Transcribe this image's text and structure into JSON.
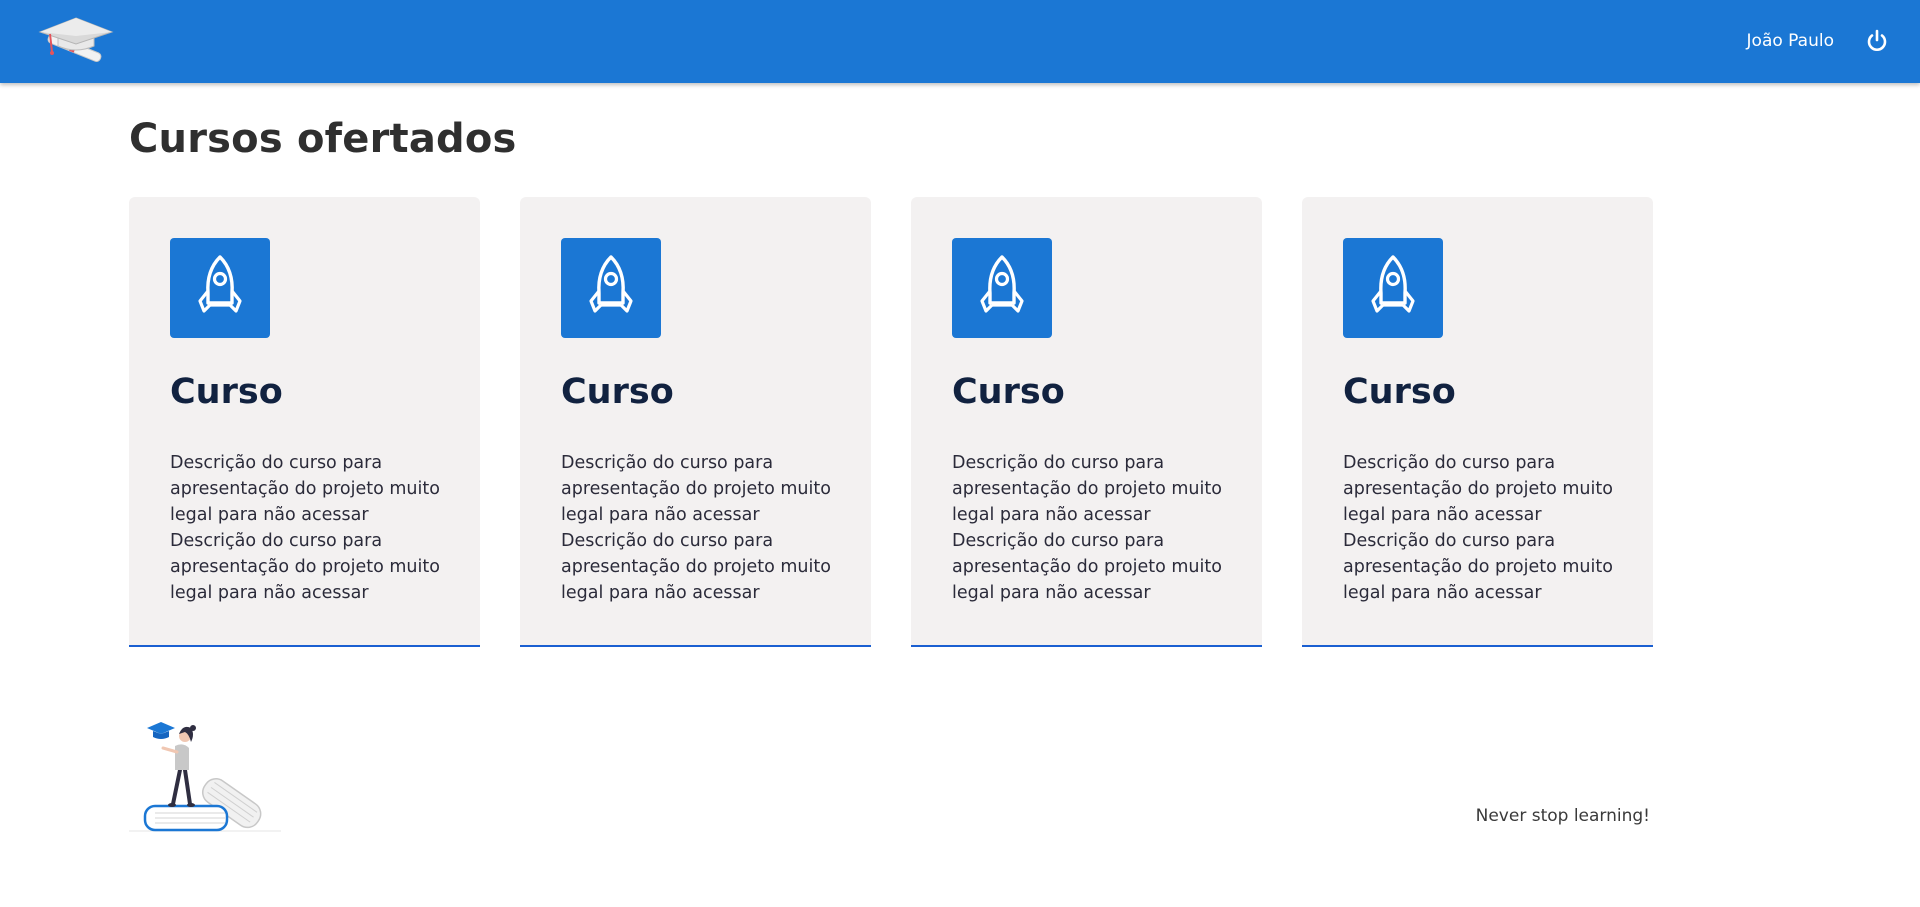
{
  "header": {
    "logo_icon": "graduation-cap-icon",
    "user_name": "João Paulo",
    "logout_icon": "power-icon",
    "background_color": "#1b77d4"
  },
  "page": {
    "title": "Cursos ofertados"
  },
  "courses": [
    {
      "icon": "rocket-icon",
      "title": "Curso",
      "description": "Descrição do curso para apresentação do projeto muito legal para não acessar Descrição do curso para apresentação do projeto muito legal para não acessar"
    },
    {
      "icon": "rocket-icon",
      "title": "Curso",
      "description": "Descrição do curso para apresentação do projeto muito legal para não acessar Descrição do curso para apresentação do projeto muito legal para não acessar"
    },
    {
      "icon": "rocket-icon",
      "title": "Curso",
      "description": "Descrição do curso para apresentação do projeto muito legal para não acessar Descrição do curso para apresentação do projeto muito legal para não acessar"
    },
    {
      "icon": "rocket-icon",
      "title": "Curso",
      "description": "Descrição do curso para apresentação do projeto muito legal para não acessar Descrição do curso para apresentação do projeto muito legal para não acessar"
    }
  ],
  "footer": {
    "illustration": "student-on-books-illustration",
    "tagline": "Never stop learning!"
  },
  "colors": {
    "accent": "#1b77d4",
    "card_background": "#f3f1f1",
    "card_border": "#1a5fd1"
  }
}
